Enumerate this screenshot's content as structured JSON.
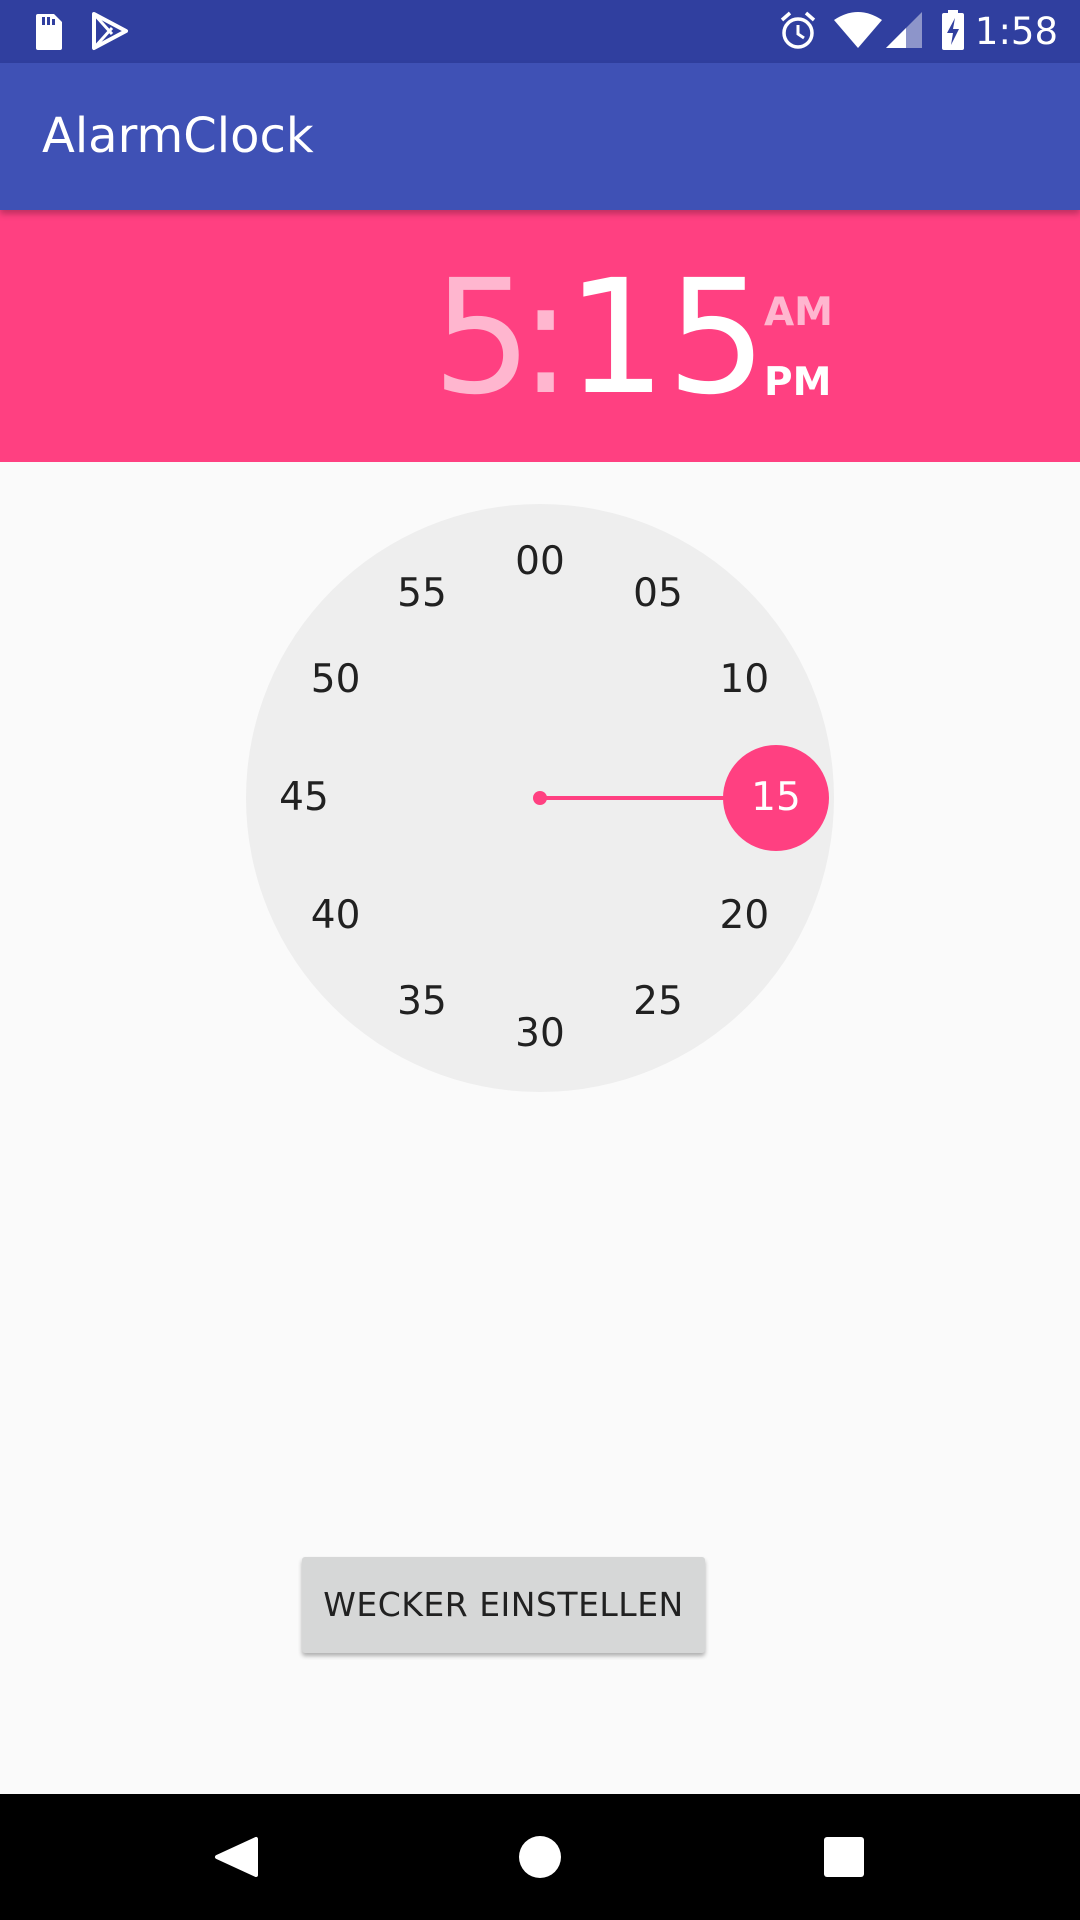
{
  "status_bar": {
    "time": "1:58",
    "left_icons": [
      "sd-card-icon",
      "play-store-icon"
    ],
    "right_icons": [
      "alarm-icon",
      "wifi-icon",
      "signal-icon",
      "battery-charging-icon"
    ]
  },
  "app_bar": {
    "title": "AlarmClock"
  },
  "time_picker": {
    "hour": "5",
    "separator": ":",
    "minute": "15",
    "am_label": "AM",
    "pm_label": "PM",
    "selected_period": "PM",
    "mode": "minutes",
    "dial_labels": [
      "00",
      "05",
      "10",
      "15",
      "20",
      "25",
      "30",
      "35",
      "40",
      "45",
      "50",
      "55"
    ],
    "selected_label": "15",
    "accent_color": "#ff4081",
    "dial_color": "#eeeeee"
  },
  "actions": {
    "set_alarm_label": "WECKER EINSTELLEN"
  },
  "nav_bar": {
    "buttons": [
      "back-icon",
      "home-icon",
      "recents-icon"
    ]
  },
  "colors": {
    "status_bar": "#303f9f",
    "app_bar": "#3f51b5",
    "header": "#ff4081",
    "background": "#fafafa",
    "button": "#d6d7d7"
  }
}
